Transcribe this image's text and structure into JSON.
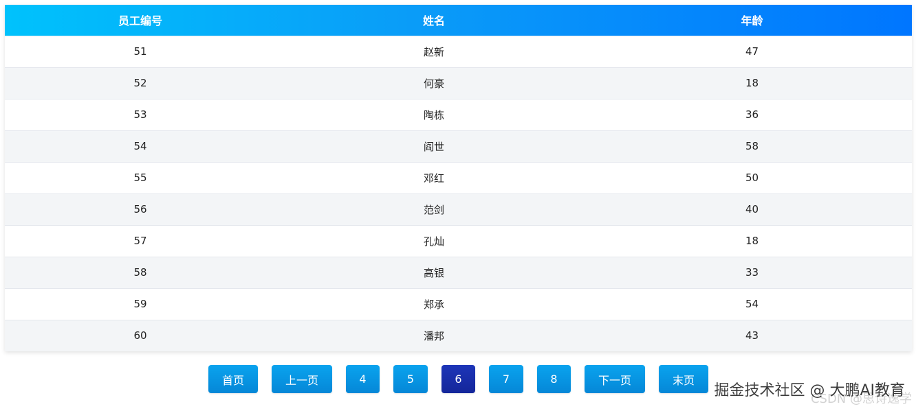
{
  "table": {
    "headers": [
      "员工编号",
      "姓名",
      "年龄"
    ],
    "rows": [
      [
        "51",
        "赵新",
        "47"
      ],
      [
        "52",
        "何豪",
        "18"
      ],
      [
        "53",
        "陶栋",
        "36"
      ],
      [
        "54",
        "阎世",
        "58"
      ],
      [
        "55",
        "邓红",
        "50"
      ],
      [
        "56",
        "范剑",
        "40"
      ],
      [
        "57",
        "孔灿",
        "18"
      ],
      [
        "58",
        "高银",
        "33"
      ],
      [
        "59",
        "郑承",
        "54"
      ],
      [
        "60",
        "潘邦",
        "43"
      ]
    ]
  },
  "pagination": {
    "first_label": "首页",
    "prev_label": "上一页",
    "pages": [
      "4",
      "5",
      "6",
      "7",
      "8"
    ],
    "current_page": "6",
    "next_label": "下一页",
    "last_label": "末页"
  },
  "watermark": {
    "text": "掘金技术社区 @ 大鹏AI教育",
    "sub_text": "CSDN @思诗逸学"
  },
  "colors": {
    "header_gradient_start": "#00c2fc",
    "header_gradient_end": "#0076ff",
    "button": "#0596e2",
    "button_active": "#1a2fae",
    "row_alt": "#f3f5f7"
  }
}
